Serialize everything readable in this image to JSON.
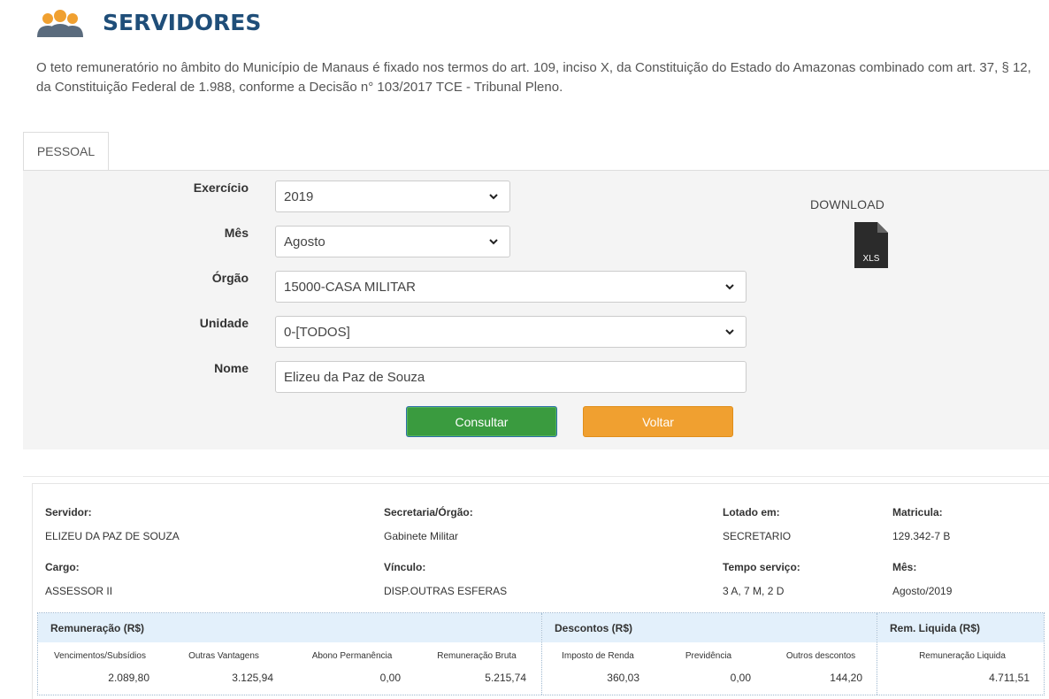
{
  "page": {
    "title": "SERVIDORES",
    "intro": "O teto remuneratório no âmbito do Município de Manaus é fixado nos termos do art. 109, inciso X, da Constituição do Estado do Amazonas combinado com art. 37, § 12, da Constituição Federal de 1.988, conforme a Decisão n° 103/2017 TCE - Tribunal Pleno.",
    "header_icon": "users-icon",
    "accent_color": "#1f4e79"
  },
  "tabs": [
    {
      "label": "PESSOAL"
    }
  ],
  "form": {
    "exercicio": {
      "label": "Exercício",
      "value": "2019"
    },
    "mes": {
      "label": "Mês",
      "value": "Agosto"
    },
    "orgao": {
      "label": "Órgão",
      "value": "15000-CASA MILITAR"
    },
    "unidade": {
      "label": "Unidade",
      "value": "0-[TODOS]"
    },
    "nome": {
      "label": "Nome",
      "value": "Elizeu da Paz de Souza"
    },
    "consultar_label": "Consultar",
    "voltar_label": "Voltar"
  },
  "download": {
    "label": "DOWNLOAD",
    "file_type": "XLS",
    "icon": "file-xls-icon"
  },
  "result": {
    "servidor": {
      "label": "Servidor:",
      "value": "ELIZEU DA PAZ DE SOUZA"
    },
    "secretaria": {
      "label": "Secretaria/Órgão:",
      "value": "Gabinete Militar"
    },
    "lotado": {
      "label": "Lotado em:",
      "value": "SECRETARIO"
    },
    "matricula": {
      "label": "Matricula:",
      "value": "129.342-7 B"
    },
    "cargo": {
      "label": "Cargo:",
      "value": "ASSESSOR II"
    },
    "vinculo": {
      "label": "Vínculo:",
      "value": "DISP.OUTRAS ESFERAS"
    },
    "tempo": {
      "label": "Tempo serviço:",
      "value": "3 A, 7 M, 2 D"
    },
    "mes": {
      "label": "Mês:",
      "value": "Agosto/2019"
    }
  },
  "table": {
    "remuneracao": {
      "title": "Remuneração (R$)",
      "columns": [
        "Vencimentos/Subsídios",
        "Outras Vantagens",
        "Abono Permanência",
        "Remuneração Bruta"
      ],
      "values": [
        "2.089,80",
        "3.125,94",
        "0,00",
        "5.215,74"
      ]
    },
    "descontos": {
      "title": "Descontos (R$)",
      "columns": [
        "Imposto de Renda",
        "Previdência",
        "Outros descontos"
      ],
      "values": [
        "360,03",
        "0,00",
        "144,20"
      ]
    },
    "liquida": {
      "title": "Rem. Liquida (R$)",
      "columns": [
        "Remuneração Liquida"
      ],
      "values": [
        "4.711,51"
      ]
    }
  }
}
